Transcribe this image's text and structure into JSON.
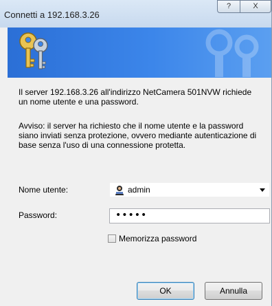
{
  "window": {
    "title": "Connetti a 192.168.3.26",
    "help_button": "?",
    "close_button": "X"
  },
  "message": {
    "intro": "Il server 192.168.3.26 all'indirizzo NetCamera 501NVW richiede un nome utente e una password.",
    "warning": "Avviso: il server ha richiesto che il nome utente e la password siano inviati senza protezione, ovvero mediante autenticazione di base senza l'uso di una connessione protetta."
  },
  "form": {
    "username_label": "Nome utente:",
    "username_value": "admin",
    "password_label": "Password:",
    "password_value": "•••••",
    "remember_label": "Memorizza password",
    "remember_checked": false
  },
  "buttons": {
    "ok": "OK",
    "cancel": "Annulla"
  },
  "icons": {
    "banner": "keys-icon",
    "user": "user-icon"
  }
}
